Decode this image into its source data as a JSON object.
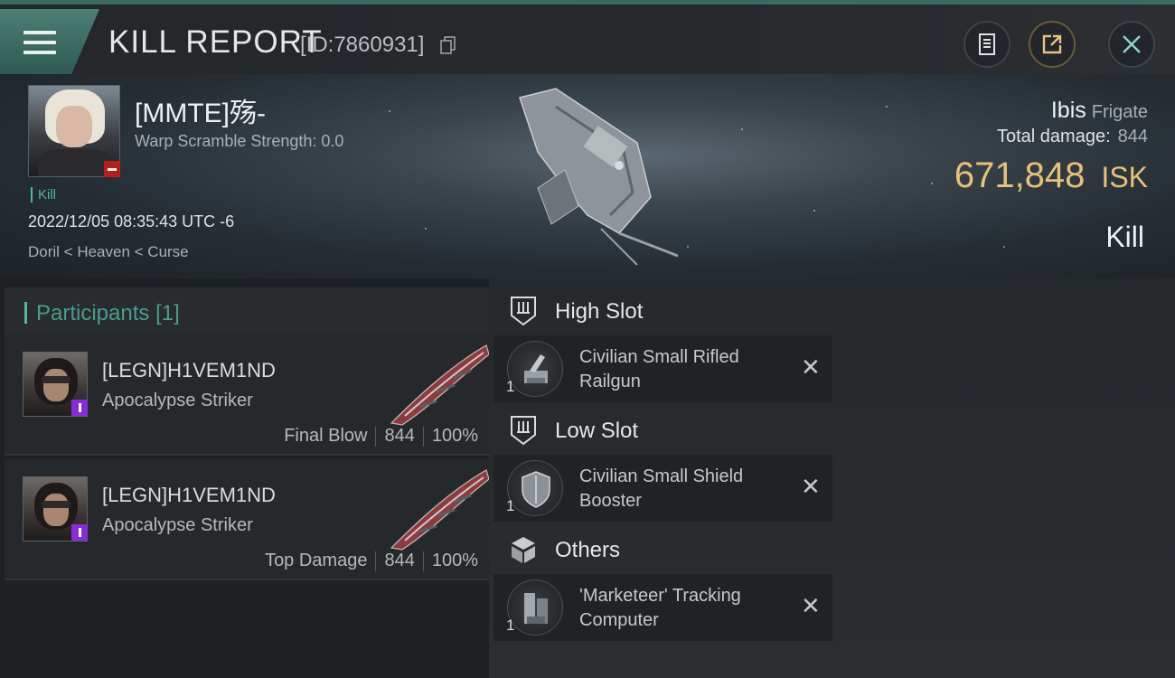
{
  "header": {
    "title": "KILL REPORT",
    "report_id": "[ID:7860931]",
    "icons": [
      "menu-icon",
      "copy-icon",
      "clipboard-icon",
      "share-icon",
      "close-icon"
    ]
  },
  "victim": {
    "name": "[MMTE]殇-",
    "warp_scramble": "Warp Scramble Strength: 0.0",
    "tag": "Kill",
    "timestamp": "2022/12/05 08:35:43 UTC -6",
    "location": "Doril < Heaven < Curse",
    "ship_name": "Ibis",
    "ship_class": "Frigate",
    "total_damage_label": "Total damage:",
    "total_damage_value": "844",
    "isk_value": "671,848",
    "isk_unit": "ISK",
    "result": "Kill"
  },
  "participants": {
    "label": "Participants",
    "count": "[1]",
    "rows": [
      {
        "name": "[LEGN]H1VEM1ND",
        "ship": "Apocalypse Striker",
        "role": "Final Blow",
        "damage": "844",
        "percent": "100%"
      },
      {
        "name": "[LEGN]H1VEM1ND",
        "ship": "Apocalypse Striker",
        "role": "Top Damage",
        "damage": "844",
        "percent": "100%"
      }
    ]
  },
  "fitting": {
    "sections": [
      {
        "title": "High Slot",
        "icon": "high-slot-icon",
        "modules": [
          {
            "name": "Civilian Small Rifled Railgun",
            "qty": "1"
          }
        ]
      },
      {
        "title": "Low Slot",
        "icon": "low-slot-icon",
        "modules": [
          {
            "name": "Civilian Small Shield Booster",
            "qty": "1"
          }
        ]
      },
      {
        "title": "Others",
        "icon": "cube-icon",
        "modules": [
          {
            "name": "'Marketeer' Tracking Computer",
            "qty": "1"
          }
        ]
      }
    ],
    "remove_glyph": "✕"
  },
  "colors": {
    "accent": "#4fb89e",
    "isk": "#e7c07a",
    "danger_badge": "#b71d1d",
    "pilot_badge": "#8a2bd8"
  }
}
